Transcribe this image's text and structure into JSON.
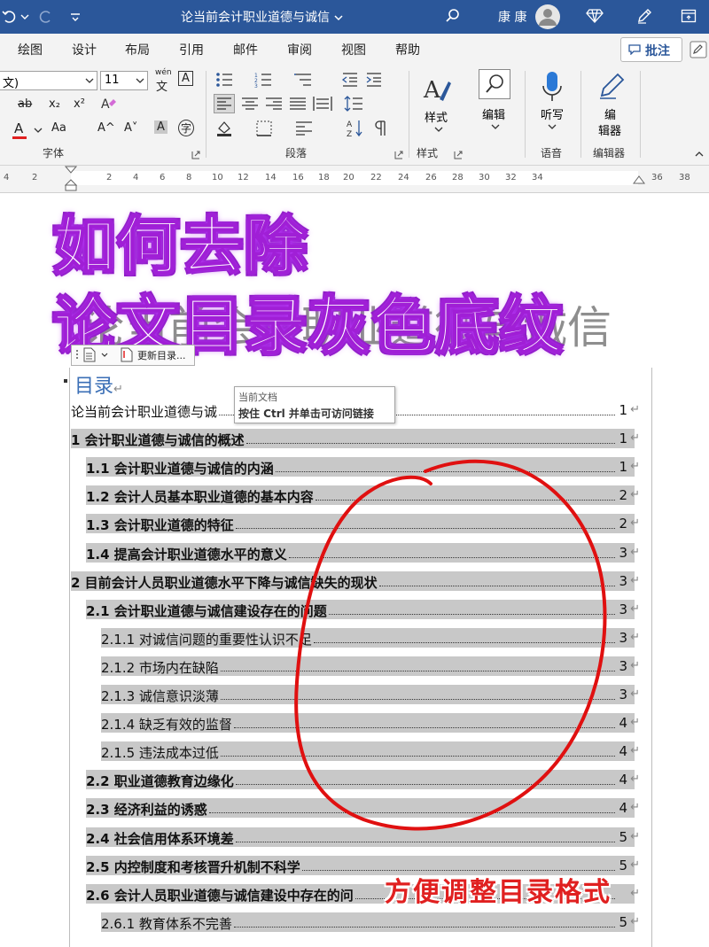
{
  "titlebar": {
    "doc_title": "论当前会计职业道德与诚信",
    "user": "康 康",
    "bg_color": "#2b579a"
  },
  "menu": {
    "items": [
      "绘图",
      "设计",
      "布局",
      "引用",
      "邮件",
      "审阅",
      "视图",
      "帮助"
    ],
    "comment_button": "批注"
  },
  "ribbon": {
    "font_name": "文)",
    "font_size": "11",
    "wen_label": "wén",
    "wen_char": "文",
    "a_box": "A",
    "strike": "ab",
    "sub": "x₂",
    "sup": "x²",
    "font_color_a": "A",
    "grow": "A^",
    "shrink": "A˅",
    "change_case": "Aa",
    "char_shade": "A",
    "enclose": "字",
    "groups": {
      "font": "字体",
      "paragraph": "段落",
      "styles": "样式",
      "voice": "语音",
      "editor": "编辑器"
    },
    "styles_button": "样式",
    "edit_button": "编辑",
    "dictate_button": "听写",
    "editor_button_1": "编",
    "editor_button_2": "辑器"
  },
  "ruler": {
    "ticks": [
      "4",
      "2",
      "2",
      "4",
      "6",
      "8",
      "10",
      "12",
      "14",
      "16",
      "18",
      "20",
      "22",
      "24",
      "26",
      "28",
      "30",
      "32",
      "34",
      "36",
      "38"
    ]
  },
  "overlay": {
    "line1": "如何去除",
    "line2": "论文目录灰色底纹",
    "caption": "方便调整目录格式",
    "circle_color": "#e01010"
  },
  "document": {
    "ghost_title": "论当前会计职业道德与诚信",
    "toc_update_button": "更新目录...",
    "toc_heading": "目录",
    "tooltip_line1": "当前文档",
    "tooltip_line2": "按住 Ctrl 并单击可访问链接",
    "return_mark": "↵",
    "entries": [
      {
        "text": "论当前会计职业道德与诚",
        "page": "1",
        "level": 0,
        "shade": false,
        "bold": false
      },
      {
        "text": "1 会计职业道德与诚信的概述",
        "page": "1",
        "level": 0,
        "shade": true,
        "bold": true
      },
      {
        "text": "1.1 会计职业道德与诚信的内涵",
        "page": "1",
        "level": 1,
        "shade": true,
        "bold": true
      },
      {
        "text": "1.2 会计人员基本职业道德的基本内容",
        "page": "2",
        "level": 1,
        "shade": true,
        "bold": true
      },
      {
        "text": "1.3 会计职业道德的特征",
        "page": "2",
        "level": 1,
        "shade": true,
        "bold": true
      },
      {
        "text": "1.4 提高会计职业道德水平的意义",
        "page": "3",
        "level": 1,
        "shade": true,
        "bold": true
      },
      {
        "text": "2 目前会计人员职业道德水平下降与诚信缺失的现状",
        "page": "3",
        "level": 0,
        "shade": true,
        "bold": true
      },
      {
        "text": "2.1 会计职业道德与诚信建设存在的问题",
        "page": "3",
        "level": 1,
        "shade": true,
        "bold": true
      },
      {
        "text": "2.1.1 对诚信问题的重要性认识不足",
        "page": "3",
        "level": 2,
        "shade": true,
        "bold": false
      },
      {
        "text": "2.1.2 市场内在缺陷",
        "page": "3",
        "level": 2,
        "shade": true,
        "bold": false
      },
      {
        "text": "2.1.3 诚信意识淡薄",
        "page": "3",
        "level": 2,
        "shade": true,
        "bold": false
      },
      {
        "text": "2.1.4 缺乏有效的监督",
        "page": "4",
        "level": 2,
        "shade": true,
        "bold": false
      },
      {
        "text": "2.1.5 违法成本过低",
        "page": "4",
        "level": 2,
        "shade": true,
        "bold": false
      },
      {
        "text": "2.2 职业道德教育边缘化",
        "page": "4",
        "level": 1,
        "shade": true,
        "bold": true
      },
      {
        "text": "2.3 经济利益的诱惑",
        "page": "4",
        "level": 1,
        "shade": true,
        "bold": true
      },
      {
        "text": "2.4 社会信用体系环境差",
        "page": "5",
        "level": 1,
        "shade": true,
        "bold": true
      },
      {
        "text": "2.5 内控制度和考核晋升机制不科学",
        "page": "5",
        "level": 1,
        "shade": true,
        "bold": true
      },
      {
        "text": "2.6 会计人员职业道德与诚信建设中存在的问",
        "page": "",
        "level": 1,
        "shade": true,
        "bold": true
      },
      {
        "text": "2.6.1 教育体系不完善",
        "page": "5",
        "level": 2,
        "shade": true,
        "bold": false
      }
    ]
  }
}
